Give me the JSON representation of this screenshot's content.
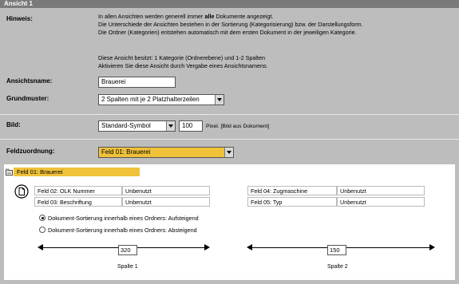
{
  "window": {
    "title": "Ansicht 1"
  },
  "hinweis": {
    "label": "Hinweis:",
    "lines": [
      "In allen Ansichten werden generell immer ",
      "alle",
      " Dokumente angezeigt.",
      "Die Unterschiede der Ansichten bestehen in der Sortierung (Kategorisierung) bzw. der Darstellungsform.",
      "Die Ordner (Kategorien) entstehen automatisch mit dem ersten Dokument in der jeweiligen Kategorie."
    ],
    "info_lines": [
      "Diese Ansicht besitzt: 1 Kategorie (Ordnerebene) und 1-2 Spalten",
      "Aktivieren Sie diese Ansicht durch Vergabe eines Ansichtsnamens."
    ]
  },
  "ansichtsname": {
    "label": "Ansichtsname:",
    "value": "Brauerei"
  },
  "grundmuster": {
    "label": "Grundmuster:",
    "value": "2 Spalten mit je 2 Platzhalterzeilen"
  },
  "bild": {
    "label": "Bild:",
    "value": "Standard-Symbol",
    "size_value": "100",
    "size_suffix": "Pixel. [Bild aus Dokument]"
  },
  "feldzuordnung": {
    "label": "Feldzuordnung:",
    "value": "Feld 01: Brauerei"
  },
  "panel": {
    "category_label": "Feld 01: Brauerei",
    "left_table": [
      {
        "field": "Feld 02: OLK Nummer",
        "value": "Unbenutzt"
      },
      {
        "field": "Feld 03: Beschriftung",
        "value": "Unbenutzt"
      }
    ],
    "right_table": [
      {
        "field": "Feld 04: Zugmaschine",
        "value": "Unbenutzt"
      },
      {
        "field": "Feld 05: Typ",
        "value": "Unbenutzt"
      }
    ],
    "sort_options": [
      {
        "label": "Dokument-Sortierung innerhalb eines Ordners: Aufsteigend",
        "checked": true
      },
      {
        "label": "Dokument-Sortierung innerhalb eines Ordners: Absteigend",
        "checked": false
      }
    ],
    "columns": [
      {
        "label": "Spalte 1",
        "width_value": "320"
      },
      {
        "label": "Spalte 2",
        "width_value": "150"
      }
    ]
  }
}
